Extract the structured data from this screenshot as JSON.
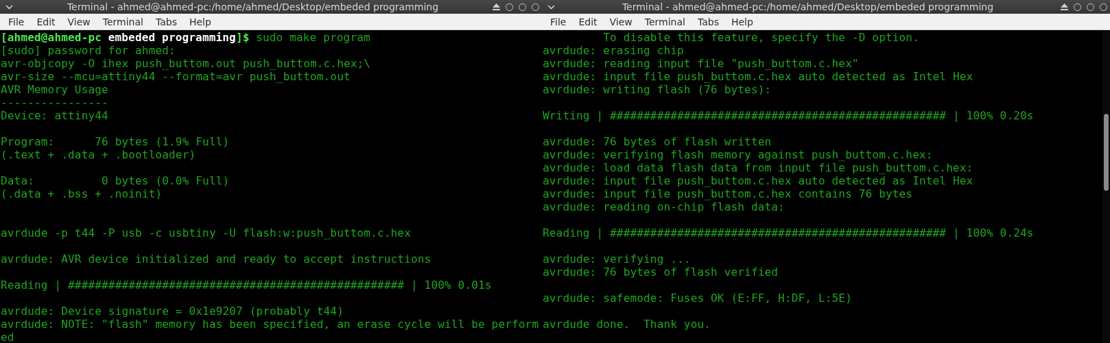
{
  "windows": [
    {
      "title": "Terminal - ahmed@ahmed-pc:/home/ahmed/Desktop/embeded programming",
      "menu": [
        "File",
        "Edit",
        "View",
        "Terminal",
        "Tabs",
        "Help"
      ],
      "scrollbar": false,
      "lines": [
        {
          "kind": "prompt",
          "user": "[ahmed@ahmed-pc",
          "directory": "embeded programming",
          "symbol": "]$",
          "command": "sudo make program"
        },
        {
          "kind": "output",
          "text": "[sudo] password for ahmed:"
        },
        {
          "kind": "output",
          "text": "avr-objcopy -O ihex push_buttom.out push_buttom.c.hex;\\"
        },
        {
          "kind": "output",
          "text": "avr-size --mcu=attiny44 --format=avr push_buttom.out"
        },
        {
          "kind": "output",
          "text": "AVR Memory Usage"
        },
        {
          "kind": "output",
          "text": "----------------"
        },
        {
          "kind": "output",
          "text": "Device: attiny44"
        },
        {
          "kind": "blank"
        },
        {
          "kind": "output",
          "text": "Program:      76 bytes (1.9% Full)"
        },
        {
          "kind": "output",
          "text": "(.text + .data + .bootloader)"
        },
        {
          "kind": "blank"
        },
        {
          "kind": "output",
          "text": "Data:          0 bytes (0.0% Full)"
        },
        {
          "kind": "output",
          "text": "(.data + .bss + .noinit)"
        },
        {
          "kind": "blank"
        },
        {
          "kind": "blank"
        },
        {
          "kind": "output",
          "text": "avrdude -p t44 -P usb -c usbtiny -U flash:w:push_buttom.c.hex"
        },
        {
          "kind": "blank"
        },
        {
          "kind": "output",
          "text": "avrdude: AVR device initialized and ready to accept instructions"
        },
        {
          "kind": "blank"
        },
        {
          "kind": "output",
          "text": "Reading | ################################################## | 100% 0.01s"
        },
        {
          "kind": "blank"
        },
        {
          "kind": "output",
          "text": "avrdude: Device signature = 0x1e9207 (probably t44)"
        },
        {
          "kind": "output",
          "text": "avrdude: NOTE: \"flash\" memory has been specified, an erase cycle will be perform"
        },
        {
          "kind": "output",
          "text": "ed"
        }
      ]
    },
    {
      "title": "Terminal - ahmed@ahmed-pc:/home/ahmed/Desktop/embeded programming",
      "menu": [
        "File",
        "Edit",
        "View",
        "Terminal",
        "Tabs",
        "Help"
      ],
      "scrollbar": true,
      "lines": [
        {
          "kind": "output",
          "text": "         To disable this feature, specify the -D option."
        },
        {
          "kind": "output",
          "text": "avrdude: erasing chip"
        },
        {
          "kind": "output",
          "text": "avrdude: reading input file \"push_buttom.c.hex\""
        },
        {
          "kind": "output",
          "text": "avrdude: input file push_buttom.c.hex auto detected as Intel Hex"
        },
        {
          "kind": "output",
          "text": "avrdude: writing flash (76 bytes):"
        },
        {
          "kind": "blank"
        },
        {
          "kind": "output",
          "text": "Writing | ################################################## | 100% 0.20s"
        },
        {
          "kind": "blank"
        },
        {
          "kind": "output",
          "text": "avrdude: 76 bytes of flash written"
        },
        {
          "kind": "output",
          "text": "avrdude: verifying flash memory against push_buttom.c.hex:"
        },
        {
          "kind": "output",
          "text": "avrdude: load data flash data from input file push_buttom.c.hex:"
        },
        {
          "kind": "output",
          "text": "avrdude: input file push_buttom.c.hex auto detected as Intel Hex"
        },
        {
          "kind": "output",
          "text": "avrdude: input file push_buttom.c.hex contains 76 bytes"
        },
        {
          "kind": "output",
          "text": "avrdude: reading on-chip flash data:"
        },
        {
          "kind": "blank"
        },
        {
          "kind": "output",
          "text": "Reading | ################################################## | 100% 0.24s"
        },
        {
          "kind": "blank"
        },
        {
          "kind": "output",
          "text": "avrdude: verifying ..."
        },
        {
          "kind": "output",
          "text": "avrdude: 76 bytes of flash verified"
        },
        {
          "kind": "blank"
        },
        {
          "kind": "output",
          "text": "avrdude: safemode: Fuses OK (E:FF, H:DF, L:5E)"
        },
        {
          "kind": "blank"
        },
        {
          "kind": "output",
          "text": "avrdude done.  Thank you."
        }
      ]
    }
  ]
}
